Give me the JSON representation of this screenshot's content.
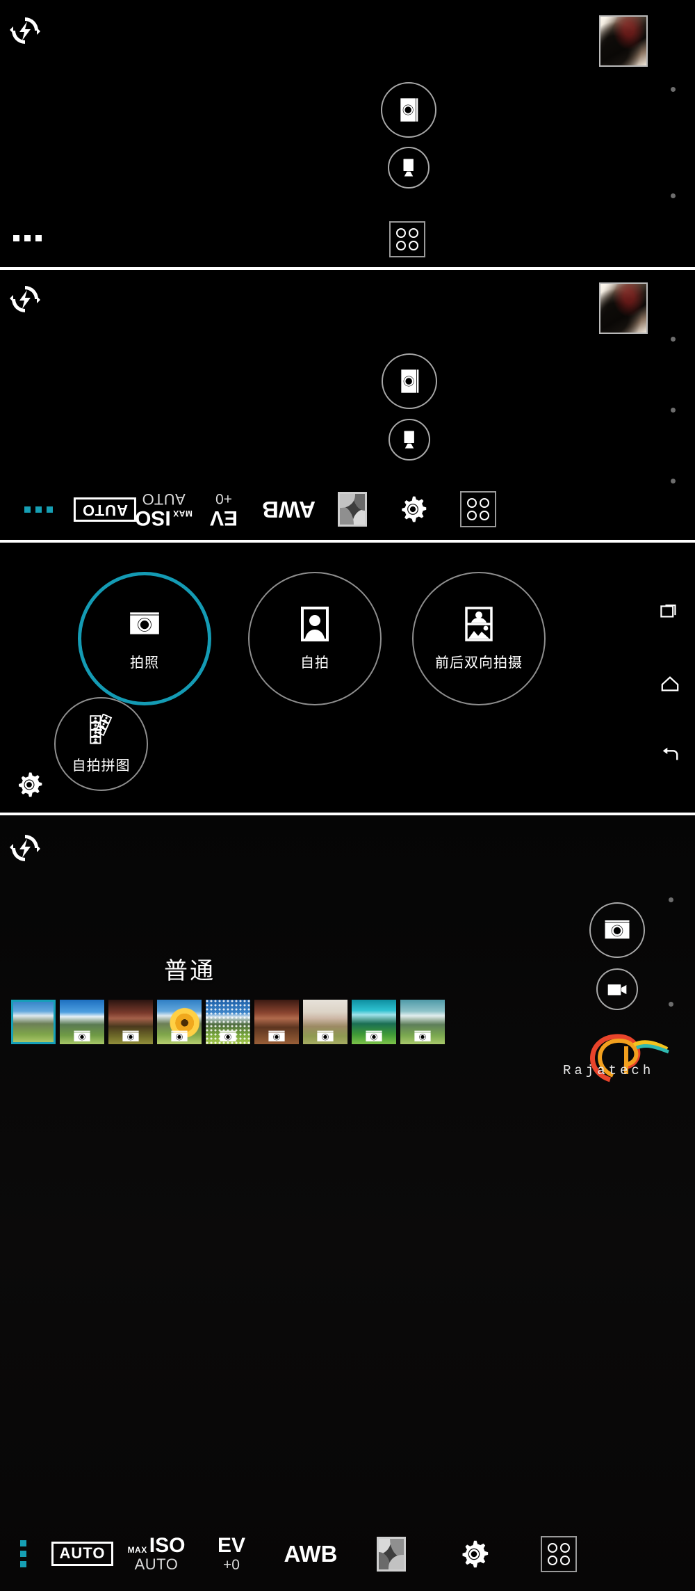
{
  "app": {
    "name": "Camera",
    "watermark": "Rajatech"
  },
  "panels": [
    {
      "id": "viewfinder-collapsed",
      "flash_icon": "flash-auto-icon",
      "thumbnail_name": "last-photo-thumbnail",
      "more_label": "more-options",
      "buttons": [
        {
          "name": "shutter-photo-button",
          "icon": "camera-icon"
        },
        {
          "name": "shutter-video-button",
          "icon": "video-icon"
        },
        {
          "name": "mode-grid-button",
          "icon": "grid-modes-icon"
        }
      ],
      "dots": 2
    },
    {
      "id": "viewfinder-toolbar-open",
      "flash_icon": "flash-auto-icon",
      "thumbnail_name": "last-photo-thumbnail",
      "buttons": [
        {
          "name": "shutter-photo-button",
          "icon": "camera-icon"
        },
        {
          "name": "shutter-video-button",
          "icon": "video-icon"
        }
      ],
      "dots": 3,
      "toolbar": {
        "more": "more-options",
        "items": [
          {
            "name": "scene-mode-button",
            "label": "AUTO",
            "icon": "auto-box-icon"
          },
          {
            "name": "iso-button",
            "max": "MAX",
            "label": "ISO",
            "value": "AUTO"
          },
          {
            "name": "ev-button",
            "label": "EV",
            "value": "+0"
          },
          {
            "name": "white-balance-button",
            "label": "AWB"
          },
          {
            "name": "effects-button",
            "icon": "effects-icon"
          },
          {
            "name": "settings-button",
            "icon": "gear-icon"
          },
          {
            "name": "modes-button",
            "icon": "grid-modes-icon"
          }
        ]
      }
    },
    {
      "id": "mode-picker",
      "settings_icon": "gear-icon",
      "modes": [
        {
          "name": "mode-photo",
          "label": "拍照",
          "icon": "camera-icon",
          "selected": true
        },
        {
          "name": "mode-selfie",
          "label": "自拍",
          "icon": "portrait-icon",
          "selected": false
        },
        {
          "name": "mode-dual",
          "label": "前后双向拍摄",
          "icon": "dual-capture-icon",
          "selected": false
        },
        {
          "name": "mode-collage",
          "label": "自拍拼图",
          "icon": "selfie-collage-icon",
          "selected": false
        }
      ],
      "nav": [
        {
          "name": "nav-recents-button",
          "icon": "recents-icon"
        },
        {
          "name": "nav-home-button",
          "icon": "home-icon"
        },
        {
          "name": "nav-back-button",
          "icon": "back-arrow-icon"
        }
      ]
    },
    {
      "id": "filter-picker",
      "flash_icon": "flash-auto-icon",
      "selected_filter_title": "普通",
      "buttons": [
        {
          "name": "shutter-photo-button",
          "icon": "camera-icon"
        },
        {
          "name": "shutter-video-button",
          "icon": "video-icon"
        }
      ],
      "dots": 2,
      "filters": [
        {
          "name": "filter-normal",
          "selected": true
        },
        {
          "name": "filter-cool",
          "selected": false
        },
        {
          "name": "filter-warm",
          "selected": false
        },
        {
          "name": "filter-bloom",
          "selected": false
        },
        {
          "name": "filter-halftone",
          "selected": false
        },
        {
          "name": "filter-sepia",
          "selected": false
        },
        {
          "name": "filter-faded",
          "selected": false
        },
        {
          "name": "filter-cyan",
          "selected": false
        },
        {
          "name": "filter-pastel",
          "selected": false
        }
      ],
      "toolbar": {
        "more": "more-options",
        "items": [
          {
            "name": "scene-mode-button",
            "label": "AUTO",
            "icon": "auto-box-icon"
          },
          {
            "name": "iso-button",
            "max": "MAX",
            "label": "ISO",
            "value": "AUTO"
          },
          {
            "name": "ev-button",
            "label": "EV",
            "value": "+0"
          },
          {
            "name": "white-balance-button",
            "label": "AWB"
          },
          {
            "name": "effects-button",
            "icon": "effects-icon"
          },
          {
            "name": "settings-button",
            "icon": "gear-icon"
          },
          {
            "name": "modes-button",
            "icon": "grid-modes-icon"
          }
        ]
      }
    }
  ],
  "colors": {
    "accent": "#149bb4",
    "background": "#000000",
    "separator": "#ffffff",
    "outline": "#a8a8a8",
    "dot": "#6d6d6d"
  }
}
